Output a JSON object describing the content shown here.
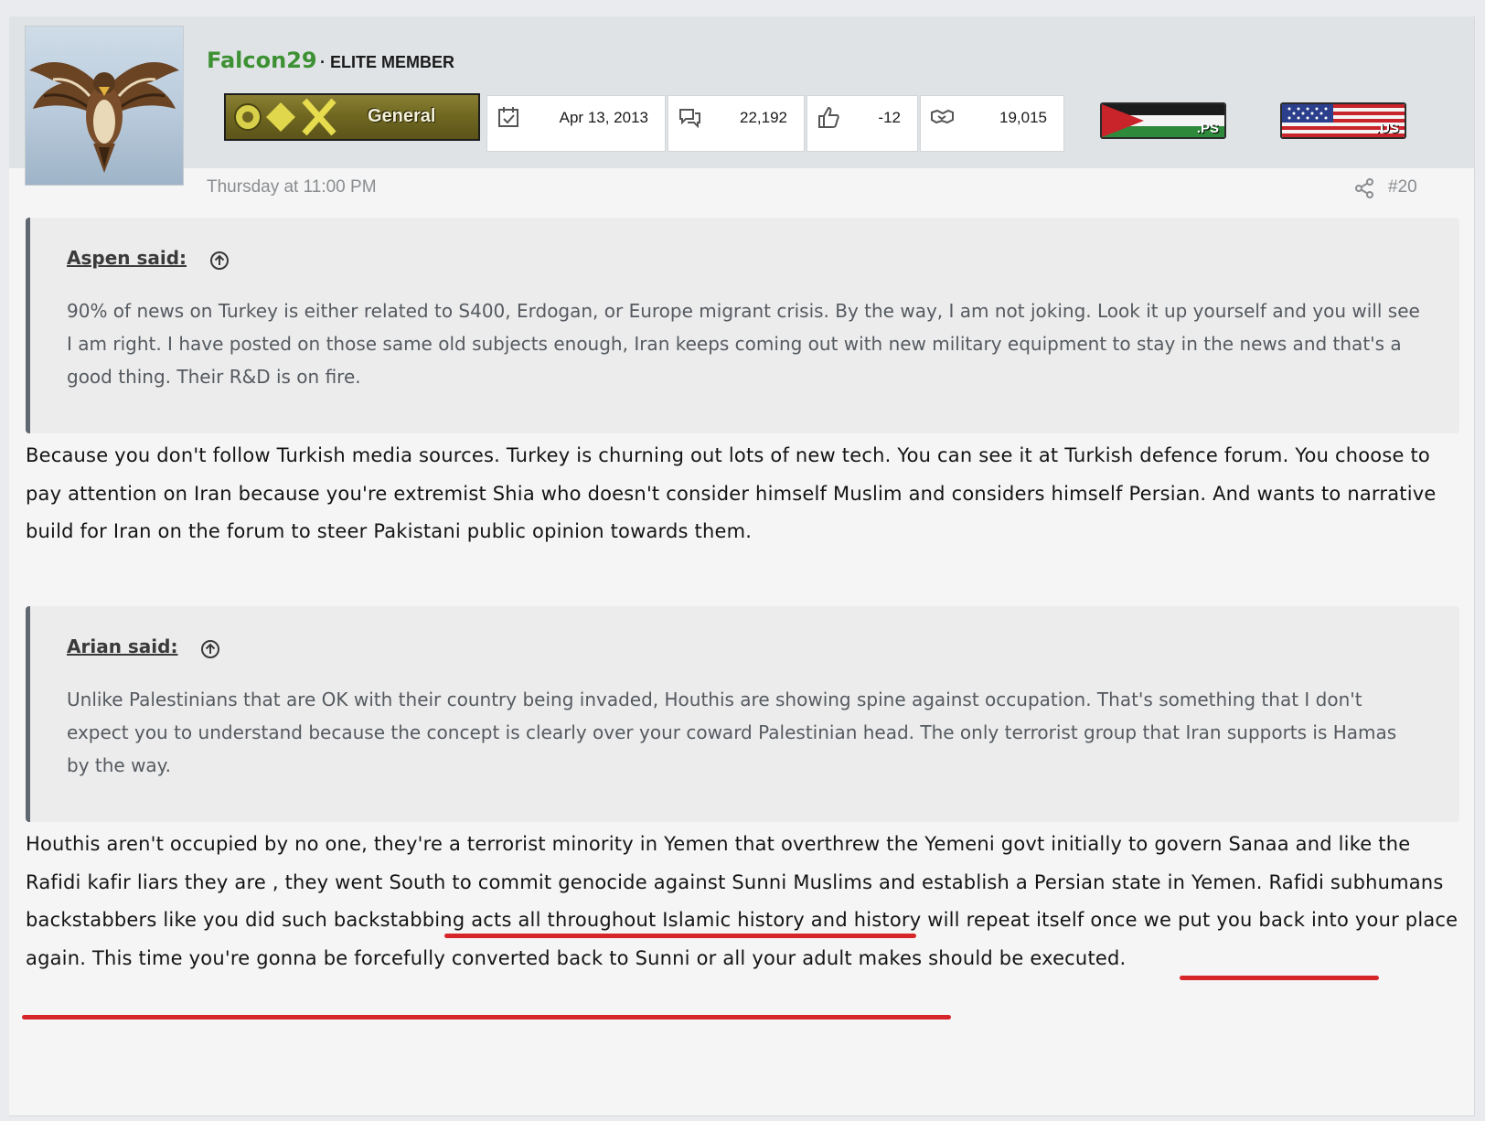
{
  "post": {
    "author": {
      "username": "Falcon29",
      "title": "· ELITE MEMBER",
      "rank_label": "General",
      "rank_color": "#6e6620",
      "avatar_icon": "falcon-avatar"
    },
    "stats": [
      {
        "icon": "calendar-icon",
        "value": "Apr 13, 2013"
      },
      {
        "icon": "messages-icon",
        "value": "22,192"
      },
      {
        "icon": "thumbs-up-icon",
        "value": "-12"
      },
      {
        "icon": "handshake-icon",
        "value": "19,015"
      }
    ],
    "flags": [
      {
        "name": "palestine-flag",
        "code": ".PS"
      },
      {
        "name": "us-flag",
        "code": ".US"
      }
    ],
    "timestamp": "Thursday at 11:00 PM",
    "post_number": "#20",
    "quotes": [
      {
        "author_label": "Aspen said:",
        "text": "90% of news on Turkey is either related to S400, Erdogan, or Europe migrant crisis. By the way, I am not joking. Look it up yourself and you will see I am right. I have posted on those same old subjects enough, Iran keeps coming out with new military equipment to stay in the news and that's a good thing. Their R&D is on fire."
      },
      {
        "author_label": "Arian said:",
        "text": "Unlike Palestinians that are OK with their country being invaded, Houthis are showing spine against occupation. That's something that I don't expect you to understand because the concept is clearly over your coward Palestinian head. The only terrorist group that Iran supports is Hamas by the way."
      }
    ],
    "replies": [
      "Because you don't follow Turkish media sources. Turkey is churning out lots of new tech. You can see it at Turkish defence forum. You choose to pay attention on Iran because you're extremist Shia who doesn't consider himself Muslim and considers himself Persian. And wants to narrative build for Iran on the forum to steer Pakistani public opinion towards them.",
      "Houthis aren't occupied by no one, they're a terrorist minority in Yemen that overthrew the Yemeni govt initially to govern Sanaa and like the Rafidi kafir liars they are , they went South to commit genocide against Sunni Muslims and establish a Persian state in Yemen. Rafidi subhumans backstabbers like you did such backstabbing acts all throughout Islamic history and history will repeat itself once we put you back into your place again. This time you're gonna be forcefully converted back to Sunni or all your adult makes should be executed."
    ],
    "annotation_color": "#d6262a"
  }
}
